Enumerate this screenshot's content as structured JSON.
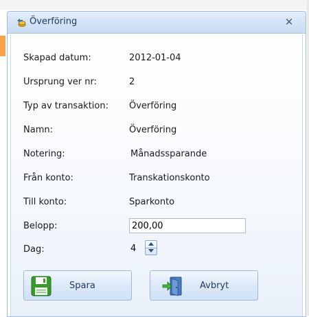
{
  "window": {
    "title": "Överföring",
    "title_icon": "transfer-coins-icon",
    "close_glyph": "✕"
  },
  "fields": [
    {
      "label": "Skapad datum:",
      "value": "2012-01-04"
    },
    {
      "label": "Ursprung ver nr:",
      "value": "2"
    },
    {
      "label": "Typ av transaktion:",
      "value": "Överföring"
    },
    {
      "label": "Namn:",
      "value": "Överföring"
    },
    {
      "label": "Notering:",
      "value": "Månadssparande"
    },
    {
      "label": "Från konto:",
      "value": "Transkationskonto"
    },
    {
      "label": "Till konto:",
      "value": "Sparkonto"
    }
  ],
  "amount": {
    "label": "Belopp:",
    "value": "200,00"
  },
  "day": {
    "label": "Dag:",
    "value": "4"
  },
  "buttons": {
    "save": {
      "label": "Spara",
      "icon": "floppy-disk-icon"
    },
    "cancel": {
      "label": "Avbryt",
      "icon": "exit-door-icon"
    }
  },
  "colors": {
    "titlebar": "#d5e4f7",
    "border": "#9dbbe0",
    "save_icon": "#3a9a2e",
    "cancel_icon": "#3b6fb6"
  }
}
